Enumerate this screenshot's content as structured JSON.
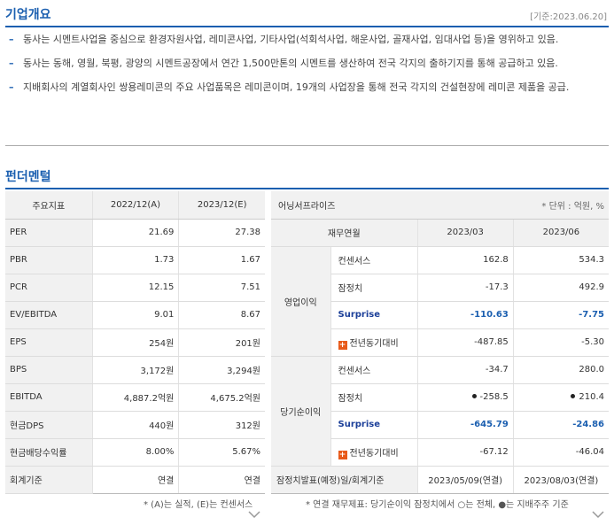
{
  "overview": {
    "title": "기업개요",
    "date_note": "[기준:2023.06.20]",
    "items": [
      "동사는 시멘트사업을 중심으로 환경자원사업, 레미콘사업, 기타사업(석회석사업, 해운사업, 골재사업, 임대사업 등)을 영위하고 있음.",
      "동사는 동해, 영월, 북평, 광양의 시멘트공장에서 연간 1,500만톤의 시멘트를 생산하여 전국 각지의 출하기지를 통해 공급하고 있음.",
      "지배회사의 계열회사인 쌍용레미콘의 주요 사업품목은 레미콘이며, 19개의 사업장을 통해 전국 각지의 건설현장에 레미콘 제품을 공급."
    ]
  },
  "fundamentals": {
    "title": "펀더멘털",
    "headers": [
      "주요지표",
      "2022/12(A)",
      "2023/12(E)"
    ],
    "rows": [
      {
        "label": "PER",
        "v1": "21.69",
        "v2": "27.38"
      },
      {
        "label": "PBR",
        "v1": "1.73",
        "v2": "1.67"
      },
      {
        "label": "PCR",
        "v1": "12.15",
        "v2": "7.51"
      },
      {
        "label": "EV/EBITDA",
        "v1": "9.01",
        "v2": "8.67"
      },
      {
        "label": "EPS",
        "v1": "254원",
        "v2": "201원"
      },
      {
        "label": "BPS",
        "v1": "3,172원",
        "v2": "3,294원"
      },
      {
        "label": "EBITDA",
        "v1": "4,887.2억원",
        "v2": "4,675.2억원"
      },
      {
        "label": "현금DPS",
        "v1": "440원",
        "v2": "312원"
      },
      {
        "label": "현금배당수익률",
        "v1": "8.00%",
        "v2": "5.67%"
      },
      {
        "label": "회계기준",
        "v1": "연결",
        "v2": "연결"
      }
    ],
    "note": "* (A)는 실적, (E)는 컨센서스"
  },
  "earnings": {
    "title": "어닝서프라이즈",
    "unit": "* 단위 : 억원, %",
    "headers": [
      "재무연월",
      "2023/03",
      "2023/06"
    ],
    "groups": [
      {
        "label": "영업이익",
        "rows": [
          {
            "label": "컨센서스",
            "v1": "162.8",
            "v2": "534.3"
          },
          {
            "label": "잠정치",
            "v1": "-17.3",
            "v2": "492.9"
          },
          {
            "label": "Surprise",
            "v1": "-110.63",
            "v2": "-7.75"
          },
          {
            "label": "전년동기대비",
            "v1": "-487.85",
            "v2": "-5.30"
          }
        ]
      },
      {
        "label": "당기순이익",
        "rows": [
          {
            "label": "컨센서스",
            "v1": "-34.7",
            "v2": "280.0"
          },
          {
            "label": "잠정치",
            "v1": "-258.5",
            "v2": "210.4"
          },
          {
            "label": "Surprise",
            "v1": "-645.79",
            "v2": "-24.86"
          },
          {
            "label": "전년동기대비",
            "v1": "-67.12",
            "v2": "-46.04"
          }
        ]
      }
    ],
    "footer": {
      "label": "잠정치발표(예정)일/회계기준",
      "v1": "2023/05/09(연결)",
      "v2": "2023/08/03(연결)"
    },
    "plus_symbol": "+",
    "note": "* 연결 재무제표: 당기순이익 잠정치에서 ○는 전체, ●는 지배주주 기준"
  },
  "colors": {
    "accent": "#1b5fb0",
    "plus": "#e85a1a"
  }
}
